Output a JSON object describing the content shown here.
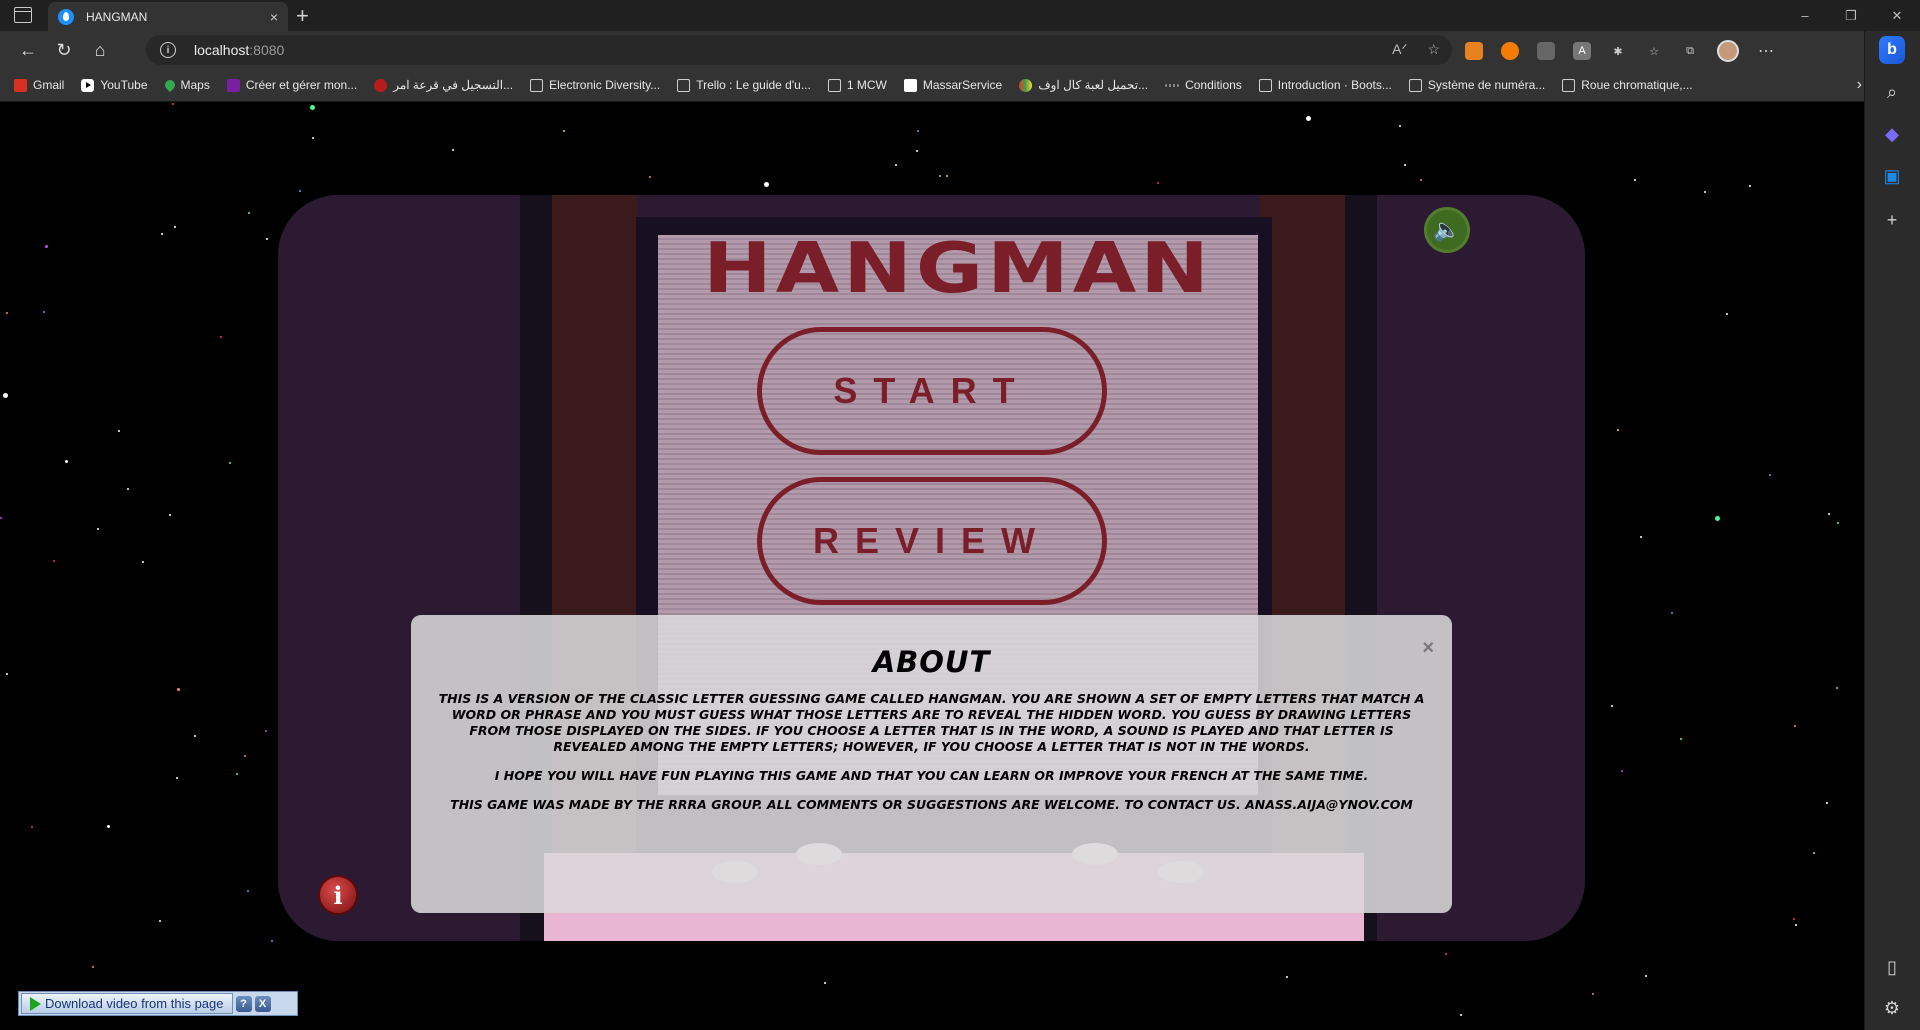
{
  "browser": {
    "tab": {
      "title": "HANGMAN",
      "close": "×"
    },
    "new_tab": "+",
    "window_controls": {
      "minimize": "–",
      "restore": "❐",
      "close": "✕"
    },
    "address": {
      "host": "localhost",
      "port": ":8080"
    },
    "bookmarks": [
      {
        "label": "Gmail",
        "icon": "gmail"
      },
      {
        "label": "YouTube",
        "icon": "yt"
      },
      {
        "label": "Maps",
        "icon": "maps"
      },
      {
        "label": "Créer et gérer mon...",
        "icon": "yellow"
      },
      {
        "label": "التسجيل في قرعة امر...",
        "icon": "arab"
      },
      {
        "label": "Electronic Diversity...",
        "icon": "page"
      },
      {
        "label": "Trello : Le guide d'u...",
        "icon": "page"
      },
      {
        "label": "1 MCW",
        "icon": "page"
      },
      {
        "label": "MassarService",
        "icon": "massar"
      },
      {
        "label": "تحميل لعبة كال اوف...",
        "icon": "tri"
      },
      {
        "label": "Conditions",
        "icon": "dots"
      },
      {
        "label": "Introduction · Boots...",
        "icon": "page"
      },
      {
        "label": "Système de numéra...",
        "icon": "page"
      },
      {
        "label": "Roue chromatique,...",
        "icon": "page"
      }
    ]
  },
  "game": {
    "title": "HANGMAN",
    "start_label": "START",
    "review_label": "REVIEW",
    "info_label": "i"
  },
  "about": {
    "title": "ABOUT",
    "close": "×",
    "p1": "This is a version of the classic letter guessing game called Hangman. You are shown a set of empty letters that match a word or phrase and you must guess what those letters are to reveal the hidden word. You guess by drawing letters from those displayed on the sides. If you choose a letter that is in the word, a sound is played and that letter is revealed among the empty letters; however, if you choose a letter that is not in the words.",
    "p2": "I hope you will have fun playing this game and that you can learn or improve your French at the same time.",
    "p3": "This game was made by the RRRA group. All comments or suggestions are welcome. To contact us. anass.aija@ynov.com"
  },
  "download_bar": {
    "label": "Download video from this page",
    "help": "?",
    "close": "X"
  },
  "colors": {
    "accent": "#7a1e2a",
    "frame": "#2c1a32",
    "sound_button": "#3e6b1f"
  }
}
